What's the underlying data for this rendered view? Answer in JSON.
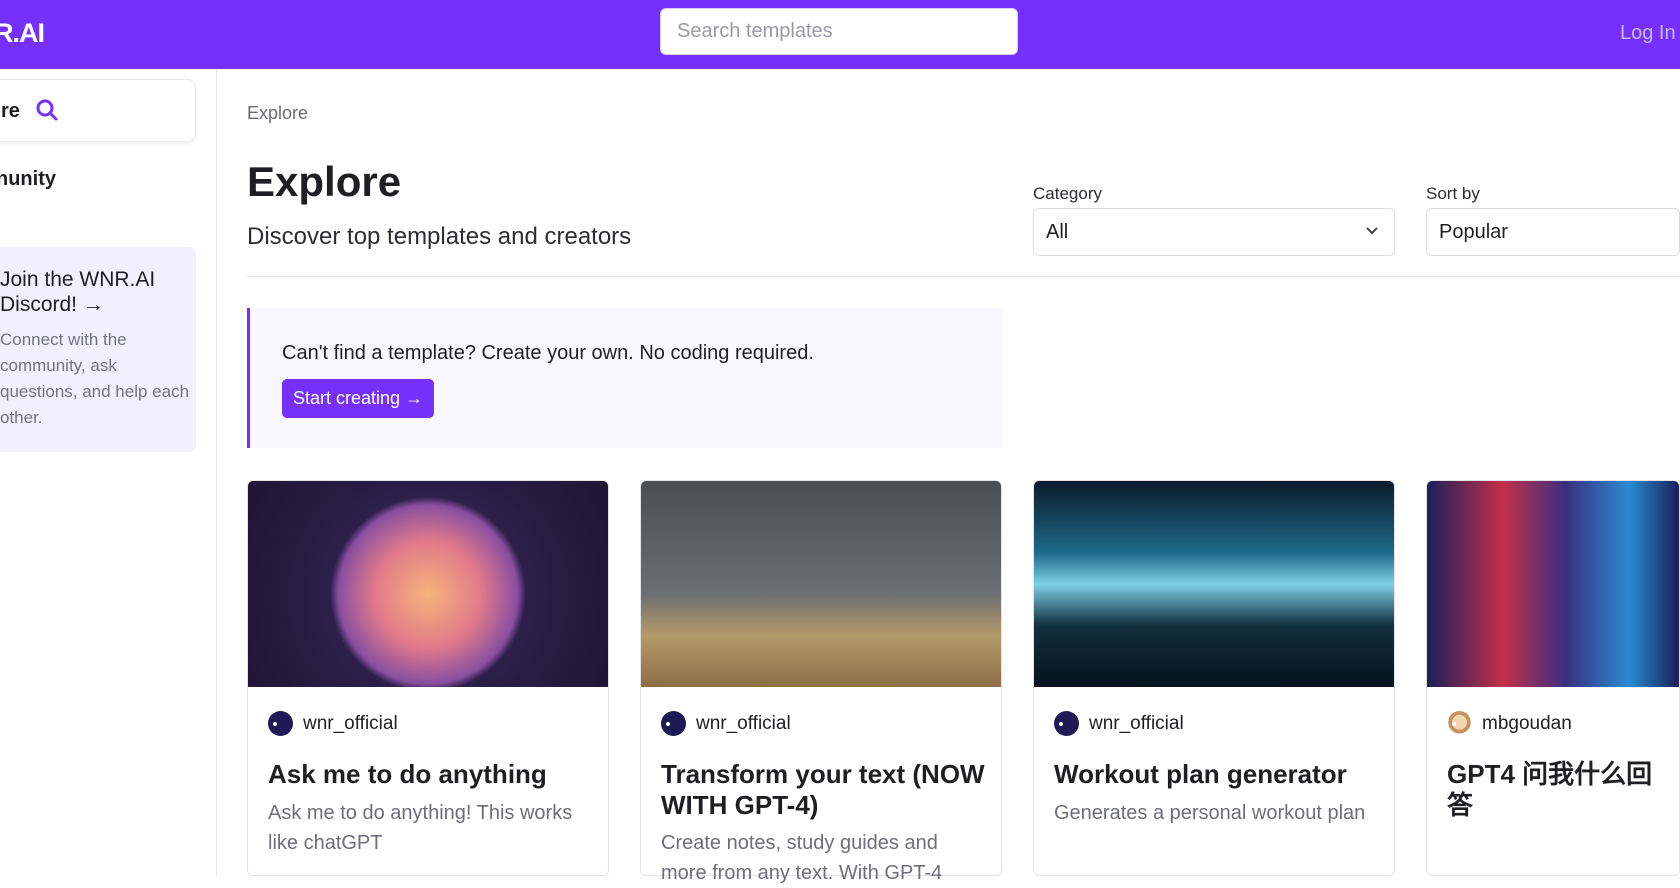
{
  "header": {
    "logo": "R.AI",
    "search_placeholder": "Search templates",
    "login": "Log In",
    "brand_color": "#7630fb"
  },
  "sidebar": {
    "search_label": "re",
    "community": "nunity",
    "discord": {
      "title": "Join the WNR.AI Discord! →",
      "text": "Connect with the community, ask questions, and help each other."
    }
  },
  "main": {
    "breadcrumb": "Explore",
    "title": "Explore",
    "subtitle": "Discover top templates and creators",
    "filters": {
      "category_label": "Category",
      "category_value": "All",
      "sort_label": "Sort by",
      "sort_value": "Popular"
    },
    "banner": {
      "text": "Can't find a template? Create your own. No coding required.",
      "button": "Start creating →"
    },
    "cards": [
      {
        "author": "wnr_official",
        "title": "Ask me to do anything",
        "description": "Ask me to do anything! This works like chatGPT"
      },
      {
        "author": "wnr_official",
        "title": "Transform your text (NOW WITH GPT-4)",
        "description": "Create notes, study guides and more from any text. With GPT-4"
      },
      {
        "author": "wnr_official",
        "title": "Workout plan generator",
        "description": "Generates a personal workout plan"
      },
      {
        "author": "mbgoudan",
        "title": "GPT4 问我什么回答",
        "description": ""
      }
    ]
  }
}
